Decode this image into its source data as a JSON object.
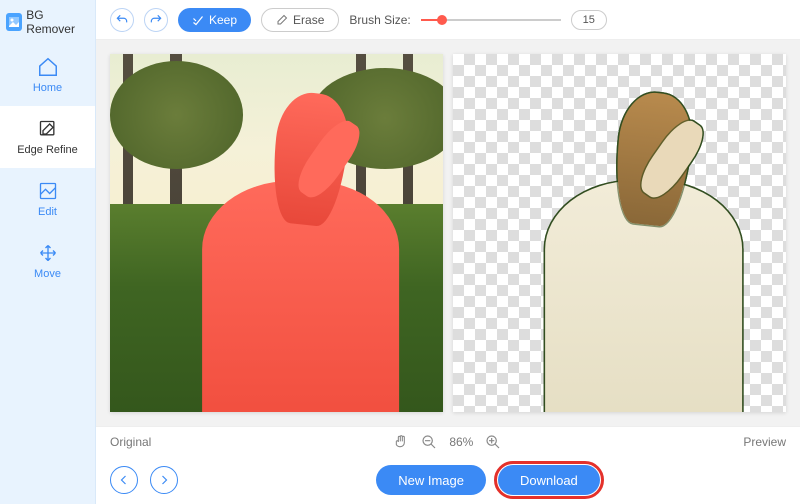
{
  "app": {
    "name": "BG Remover"
  },
  "sidebar": {
    "items": [
      {
        "label": "Home"
      },
      {
        "label": "Edge Refine"
      },
      {
        "label": "Edit"
      },
      {
        "label": "Move"
      }
    ]
  },
  "toolbar": {
    "keep_label": "Keep",
    "erase_label": "Erase",
    "brush_label": "Brush Size:",
    "brush_value": "15",
    "brush_min": 1,
    "brush_max": 100,
    "brush_percent": 15
  },
  "status": {
    "original_label": "Original",
    "preview_label": "Preview",
    "zoom": "86%"
  },
  "footer": {
    "new_image_label": "New Image",
    "download_label": "Download"
  }
}
